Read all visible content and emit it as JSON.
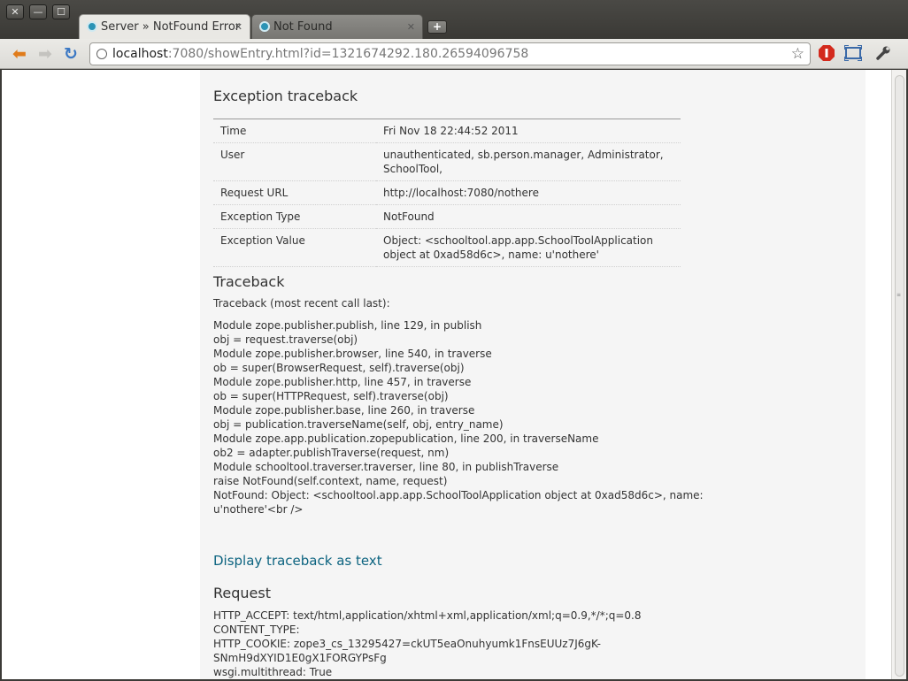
{
  "window": {
    "close_glyph": "✕",
    "minimize_glyph": "—",
    "maximize_glyph": "☐"
  },
  "tabs": [
    {
      "title": "Server » NotFound Error",
      "active": true
    },
    {
      "title": "Not Found",
      "active": false
    }
  ],
  "toolbar": {
    "url_host": "localhost",
    "url_rest": ":7080/showEntry.html?id=1321674292.180.26594096758"
  },
  "page": {
    "exception_heading": "Exception traceback",
    "info_rows": [
      {
        "key": "Time",
        "value": "Fri Nov 18 22:44:52 2011"
      },
      {
        "key": "User",
        "value": "unauthenticated, sb.person.manager, Administrator, SchoolTool,"
      },
      {
        "key": "Request URL",
        "value": "http://localhost:7080/nothere"
      },
      {
        "key": "Exception Type",
        "value": "NotFound"
      },
      {
        "key": "Exception Value",
        "value": "Object: <schooltool.app.app.SchoolToolApplication object at 0xad58d6c>, name: u'nothere'"
      }
    ],
    "traceback_heading": "Traceback",
    "traceback_intro": "Traceback (most recent call last):",
    "traceback_lines": [
      "Module zope.publisher.publish, line 129, in publish",
      "obj = request.traverse(obj)",
      "Module zope.publisher.browser, line 540, in traverse",
      "ob = super(BrowserRequest, self).traverse(obj)",
      "Module zope.publisher.http, line 457, in traverse",
      "ob = super(HTTPRequest, self).traverse(obj)",
      "Module zope.publisher.base, line 260, in traverse",
      "obj = publication.traverseName(self, obj, entry_name)",
      "Module zope.app.publication.zopepublication, line 200, in traverseName",
      "ob2 = adapter.publishTraverse(request, nm)",
      "Module schooltool.traverser.traverser, line 80, in publishTraverse",
      "raise NotFound(self.context, name, request)",
      "NotFound: Object: <schooltool.app.app.SchoolToolApplication object at 0xad58d6c>, name:",
      "u'nothere'<br />"
    ],
    "display_text_link": "Display traceback as text",
    "request_heading": "Request",
    "request_lines": [
      "HTTP_ACCEPT: text/html,application/xhtml+xml,application/xml;q=0.9,*/*;q=0.8",
      "CONTENT_TYPE:",
      "HTTP_COOKIE: zope3_cs_13295427=ckUT5eaOnuhyumk1FnsEUUz7J6gK-",
      "SNmH9dXYID1E0gX1FORGYPsFg",
      "wsgi.multithread: True"
    ]
  }
}
